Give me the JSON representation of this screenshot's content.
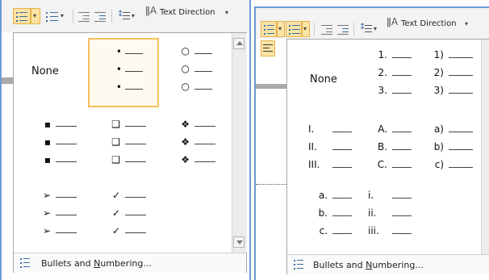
{
  "left_panel": {
    "ribbon": {
      "text_direction_label": "Text Direction",
      "dropdown_caret": "▾"
    },
    "none_label": "None",
    "bullet_library": [
      [
        "•",
        "○"
      ],
      [
        "▪",
        "❑",
        "❖"
      ],
      [
        "➢",
        "✓"
      ]
    ],
    "footer": {
      "label_prefix": "Bullets and ",
      "label_underlined": "N",
      "label_suffix": "umbering..."
    }
  },
  "right_panel": {
    "ribbon": {
      "text_direction_label": "Text Direction",
      "dropdown_caret": "▾"
    },
    "none_label": "None",
    "numbering_library": [
      [
        "1.",
        "2.",
        "3."
      ],
      [
        "1)",
        "2)",
        "3)"
      ],
      [
        "I.",
        "II.",
        "III."
      ],
      [
        "A.",
        "B.",
        "C."
      ],
      [
        "a)",
        "b)",
        "c)"
      ],
      [
        "a.",
        "b.",
        "c."
      ],
      [
        "i.",
        "ii.",
        "iii."
      ]
    ],
    "footer": {
      "label_prefix": "Bullets and ",
      "label_underlined": "N",
      "label_suffix": "umbering..."
    }
  }
}
